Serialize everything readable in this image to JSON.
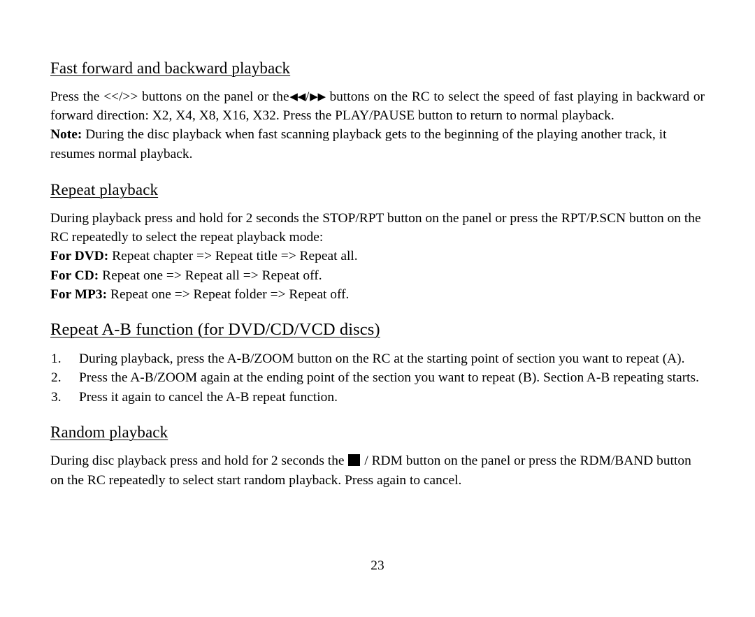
{
  "document": {
    "page_number": "23",
    "sections": [
      {
        "id": "fast-forward",
        "heading": "Fast forward and backward playback",
        "paragraphs": [
          {
            "id": "fast-forward-main",
            "part1": "Press the <</>> buttons on the panel or the",
            "rewind_icon": "◀◀",
            "separator": "/",
            "forward_icon": "▶▶",
            "part2": "buttons on the RC to select the speed of fast playing in backward or forward direction: X2, X4, X8, X16, X32. Press the PLAY/PAUSE button to return to normal playback."
          },
          {
            "id": "fast-forward-note",
            "label": "Note:",
            "text": "During the disc playback when fast scanning playback gets to the beginning of the playing another track, it resumes normal playback."
          }
        ]
      },
      {
        "id": "repeat-playback",
        "heading": "Repeat playback",
        "intro": "During playback press and hold for 2 seconds the STOP/RPT button on the panel or press the RPT/P.SCN button on the RC repeatedly to select the repeat playback mode:",
        "modes": [
          {
            "label": "For DVD:",
            "text": "Repeat chapter => Repeat title => Repeat all."
          },
          {
            "label": "For CD:",
            "text": "Repeat one => Repeat all => Repeat off."
          },
          {
            "label": "For MP3:",
            "text": "Repeat one => Repeat folder => Repeat off."
          }
        ]
      },
      {
        "id": "repeat-ab",
        "heading": "Repeat A-B function (for DVD/CD/VCD discs)",
        "steps": [
          "During playback, press the A-B/ZOOM button on the RC at the starting point of section you want to repeat (A).",
          "Press the A-B/ZOOM again at the ending point of the section you want to repeat (B). Section A-B repeating starts.",
          "Press it again to cancel the A-B repeat function."
        ]
      },
      {
        "id": "random-playback",
        "heading": "Random playback",
        "paragraph": {
          "part1": "During disc playback press and hold for 2 seconds the",
          "stop_icon": "■",
          "part2": "/ RDM button on the panel or press the RDM/BAND button on the RC repeatedly to select start random playback. Press again to cancel."
        }
      }
    ]
  }
}
